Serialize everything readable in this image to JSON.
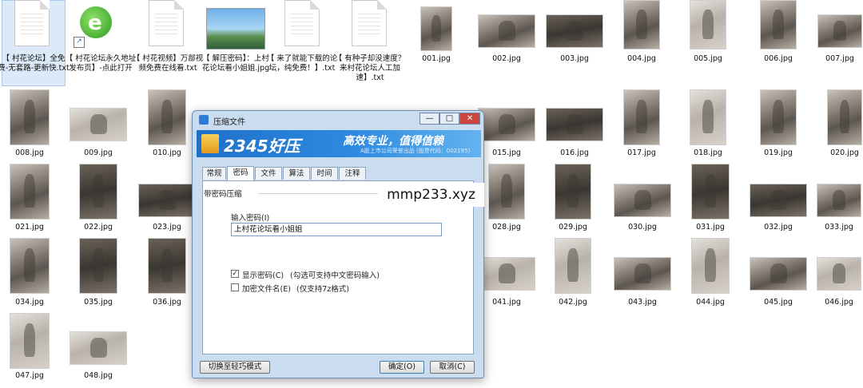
{
  "desktop_files": [
    {
      "name": "【 村花论坛】全免费-无套路-更新快.txt"
    },
    {
      "name": "【 村花论坛永久地址发布页】-点此打开"
    },
    {
      "name": "【 村花视频】万部视频免费在线看.txt"
    },
    {
      "name": "【 解压密码】：上村花论坛看小姐姐.jpg"
    },
    {
      "name": "【 来了就能下载的论坛，纯免费！】.txt"
    },
    {
      "name": "【 有种子却没速度？来村花论坛人工加速】.txt"
    }
  ],
  "images": [
    "001.jpg",
    "002.jpg",
    "003.jpg",
    "004.jpg",
    "005.jpg",
    "006.jpg",
    "007.jpg",
    "008.jpg",
    "009.jpg",
    "010.jpg",
    "015.jpg",
    "016.jpg",
    "017.jpg",
    "018.jpg",
    "019.jpg",
    "020.jpg",
    "021.jpg",
    "022.jpg",
    "023.jpg",
    "028.jpg",
    "029.jpg",
    "030.jpg",
    "031.jpg",
    "032.jpg",
    "033.jpg",
    "034.jpg",
    "035.jpg",
    "036.jpg",
    "041.jpg",
    "042.jpg",
    "043.jpg",
    "044.jpg",
    "045.jpg",
    "046.jpg",
    "047.jpg",
    "048.jpg"
  ],
  "dialog": {
    "title": "压缩文件",
    "minimize": "—",
    "maximize": "□",
    "close": "✕",
    "banner_brand": "2345好压",
    "banner_slogan": "高效专业，值得信赖",
    "banner_sub": "A股上市公司荣誉出品 (股票代码：002195)",
    "tabs": [
      "常规",
      "密码",
      "文件",
      "算法",
      "时间",
      "注释"
    ],
    "active_tab": "密码",
    "group_label": "带密码压缩",
    "password_label": "输入密码(I)",
    "password_value": "上村花论坛看小姐姐",
    "show_password": {
      "checked": true,
      "label": "显示密码(C)",
      "hint": "(勾选可支持中文密码输入)"
    },
    "encrypt_names": {
      "checked": false,
      "label": "加密文件名(E)",
      "hint": "(仅支持7z格式)"
    },
    "btn_light_mode": "切换至轻巧模式",
    "btn_ok": "确定(O)",
    "btn_cancel": "取消(C)"
  },
  "watermark": "mmp233.xyz"
}
